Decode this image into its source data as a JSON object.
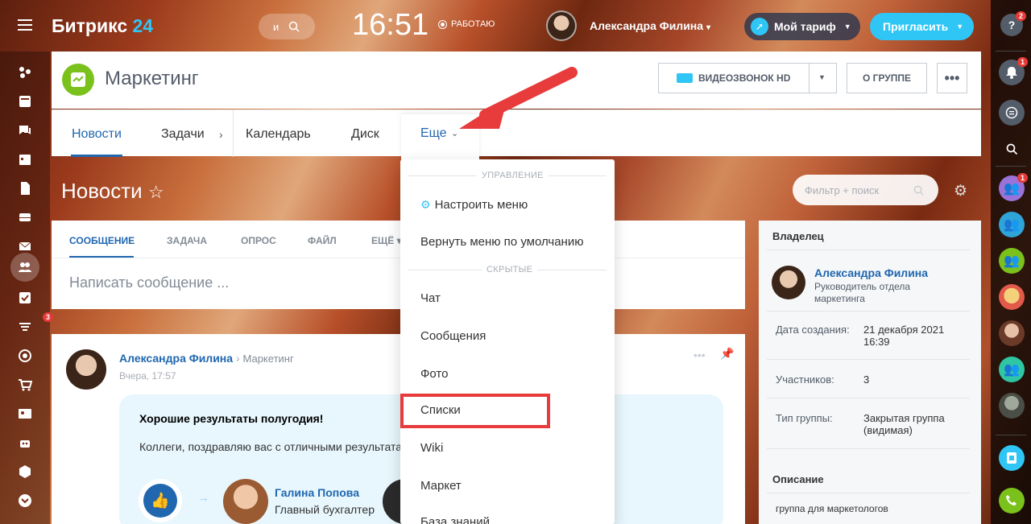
{
  "header": {
    "logo_main": "Битрикс",
    "logo_num": "24",
    "search_letter": "и",
    "time": "16:51",
    "status": "РАБОТАЮ",
    "user_name": "Александра Филина",
    "tariff_label": "Мой тариф",
    "invite_label": "Пригласить",
    "help_badge": "2"
  },
  "group": {
    "title": "Маркетинг",
    "video_label": "ВИДЕОЗВОНОК HD",
    "about_label": "О ГРУППЕ",
    "tabs": [
      "Новости",
      "Задачи",
      "Календарь",
      "Диск",
      "Еще"
    ]
  },
  "news": {
    "title": "Новости",
    "filter_placeholder": "Фильтр + поиск",
    "composer_tabs": [
      "СООБЩЕНИЕ",
      "ЗАДАЧА",
      "ОПРОС",
      "ФАЙЛ",
      "ЕЩЁ"
    ],
    "composer_placeholder": "Написать сообщение ..."
  },
  "post": {
    "author": "Александра Филина",
    "dest": "Маркетинг",
    "time": "Вчера, 17:57",
    "headline": "Хорошие результаты полугодия!",
    "text": "Коллеги, поздравляю вас с отличными результатами",
    "thank_name": "Галина Попова",
    "thank_role": "Главный бухгалтер"
  },
  "menu": {
    "section_manage": "УПРАВЛЕНИЕ",
    "configure": "Настроить меню",
    "reset": "Вернуть меню по умолчанию",
    "section_hidden": "СКРЫТЫЕ",
    "hidden_items": [
      "Чат",
      "Сообщения",
      "Фото",
      "Списки",
      "Wiki",
      "Маркет",
      "База знаний"
    ]
  },
  "info": {
    "owner_label": "Владелец",
    "owner_name": "Александра Филина",
    "owner_role": "Руководитель отдела маркетинга",
    "created_label": "Дата создания:",
    "created_value": "21 декабря 2021 16:39",
    "members_label": "Участников:",
    "members_value": "3",
    "type_label": "Тип группы:",
    "type_value": "Закрытая группа (видимая)",
    "desc_label": "Описание",
    "desc_value": "группа для маркетологов"
  },
  "leftbar_badge": "3",
  "rightbar": {
    "notif_badge": "1",
    "chat_badge": "1"
  },
  "colors": {
    "accent": "#2fc6f6",
    "link": "#2067b0",
    "highlight": "#e83b3b",
    "group_icon": "#7bc11c"
  }
}
